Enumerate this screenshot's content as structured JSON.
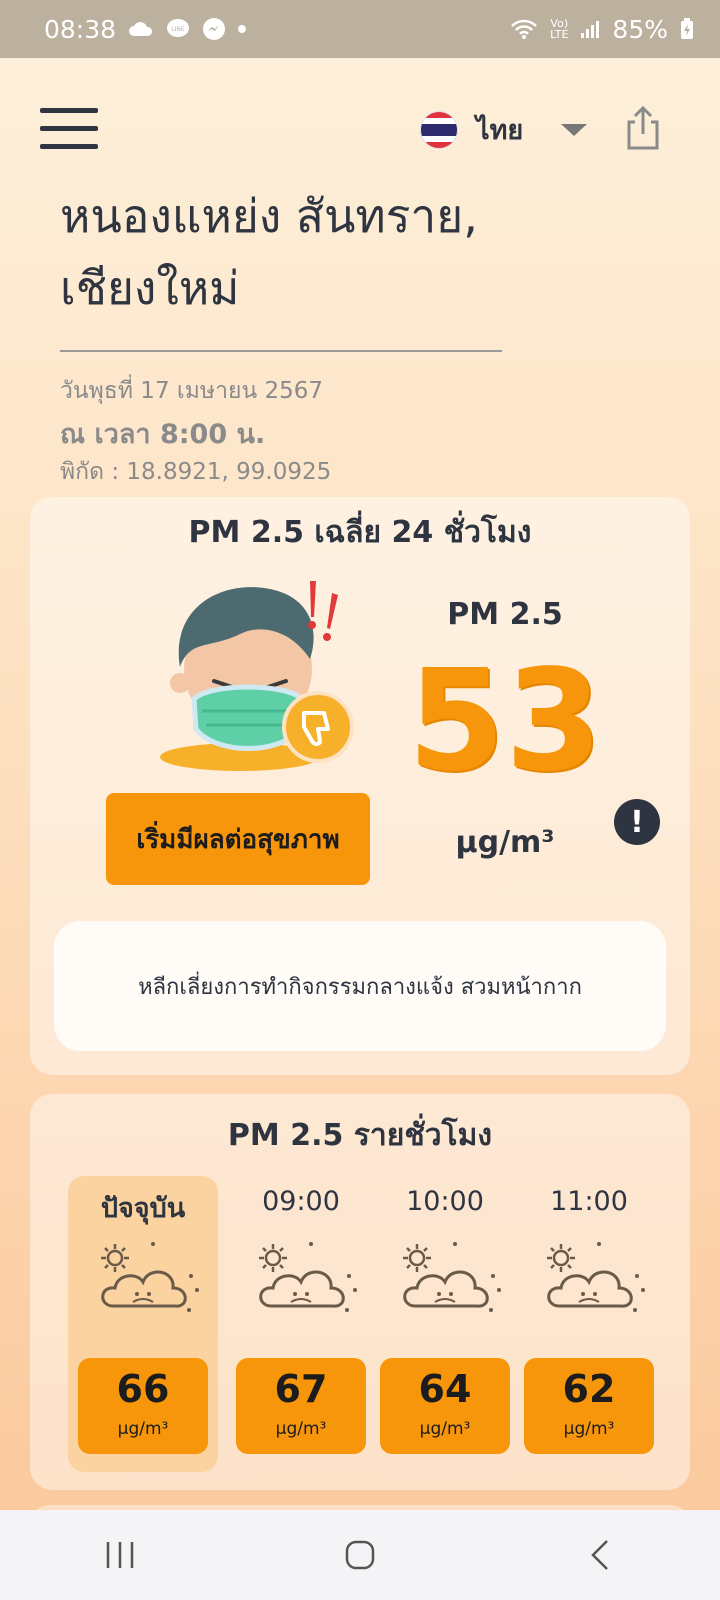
{
  "status_bar": {
    "time": "08:38",
    "battery": "85%",
    "lte": "LTE"
  },
  "header": {
    "language": "ไทย"
  },
  "location": {
    "name": "หนองแหย่ง สันทราย, เชียงใหม่"
  },
  "info": {
    "date": "วันพุธที่ 17 เมษายน 2567",
    "time": "ณ เวลา 8:00 น.",
    "coords": "พิกัด : 18.8921, 99.0925"
  },
  "daily": {
    "title": "PM 2.5 เฉลี่ย 24 ชั่วโมง",
    "status": "เริ่มมีผลต่อสุขภาพ",
    "pm_label": "PM 2.5",
    "value": "53",
    "unit": "µg/m³",
    "info_symbol": "!",
    "advice": "หลีกเลี่ยงการทำกิจกรรมกลางแจ้ง สวมหน้ากาก",
    "color": "#f7960a"
  },
  "hourly": {
    "title": "PM 2.5 รายชั่วโมง",
    "unit": "µg/m³",
    "items": [
      {
        "label": "ปัจจุบัน",
        "value": "66",
        "icon": "hazy-cloud-icon"
      },
      {
        "label": "09:00",
        "value": "67",
        "icon": "hazy-cloud-icon"
      },
      {
        "label": "10:00",
        "value": "64",
        "icon": "hazy-cloud-icon"
      },
      {
        "label": "11:00",
        "value": "62",
        "icon": "hazy-cloud-icon"
      }
    ]
  }
}
